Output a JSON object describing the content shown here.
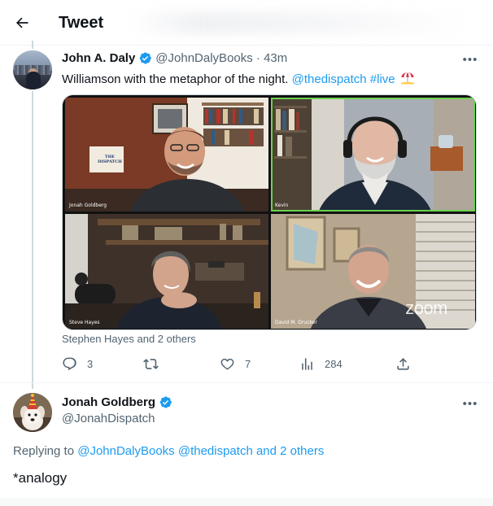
{
  "header": {
    "title": "Tweet",
    "back_icon": "arrow-left-icon"
  },
  "tweet": {
    "author_name": "John A. Daly",
    "handle": "@JohnDalyBooks",
    "time": "43m",
    "text_plain": "Williamson with the metaphor of the night. ",
    "mention": "@thedispatch",
    "hashtag": "#live",
    "emoji": "beach-umbrella-icon",
    "media_labels": {
      "tile1": "Jonah Goldberg",
      "tile2": "Kevin",
      "tile3": "Steve Hayes",
      "tile4": "David M. Drucker"
    },
    "media_brand": "THE DISPATCH",
    "zoom_watermark": "zoom",
    "tagged": "Stephen Hayes and 2 others",
    "replies": "3",
    "retweets": "",
    "likes": "7",
    "views": "284"
  },
  "reply": {
    "author_name": "Jonah Goldberg",
    "handle": "@JonahDispatch",
    "replying_prefix": "Replying to ",
    "replying_to": "@JohnDalyBooks @thedispatch and 2 others",
    "text": "*analogy"
  },
  "colors": {
    "accent": "#1d9bf0",
    "text": "#0f1419",
    "muted": "#536471",
    "verified": "#1d9bf0"
  }
}
